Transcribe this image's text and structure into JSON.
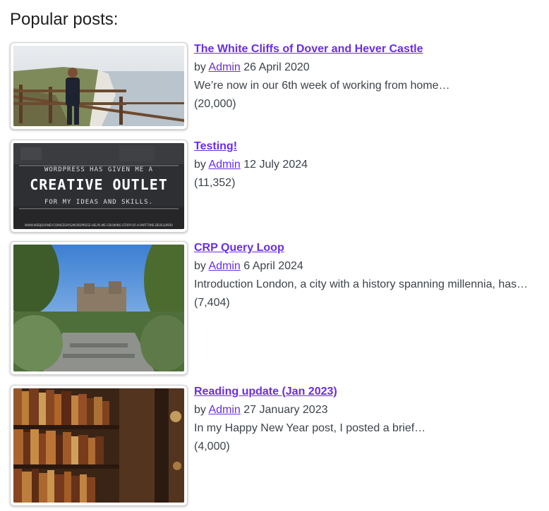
{
  "heading": "Popular posts:",
  "author_prefix": "by",
  "posts": [
    {
      "title": "The White Cliffs of Dover and Hever Castle",
      "author": "Admin",
      "date": "26 April 2020",
      "excerpt": "We’re now in our 6th week of working from home…",
      "views": "(20,000)"
    },
    {
      "title": "Testing!",
      "author": "Admin",
      "date": "12 July 2024",
      "excerpt": "",
      "views": "(11,352)",
      "image_text": {
        "line1": "WORDPRESS HAS GIVEN ME A",
        "line2": "CREATIVE OUTLET",
        "line3": "FOR MY IDEAS AND SKILLS.",
        "footer": "WWW.WEBJOURNEY.COM/ESSAYS/WORDPRESS-HELPS-ME-GROWING-STORY-OF-A-PART-TIME-DEVELOPER/"
      }
    },
    {
      "title": "CRP Query Loop",
      "author": "Admin",
      "date": "6 April 2024",
      "excerpt": "Introduction London, a city with a history spanning millennia, has…",
      "views": "(7,404)"
    },
    {
      "title": "Reading update (Jan 2023)",
      "author": "Admin",
      "date": "27 January 2023",
      "excerpt": "In my Happy New Year post, I posted a brief…",
      "views": "(4,000)"
    }
  ],
  "colors": {
    "link": "#6a2ce8",
    "text": "#3c434a",
    "heading": "#1e1e1e"
  }
}
